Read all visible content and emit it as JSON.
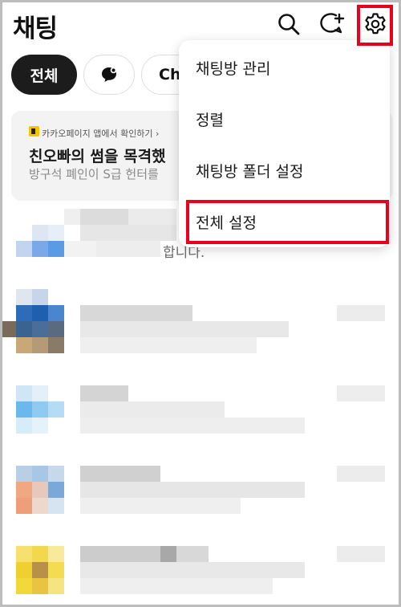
{
  "header": {
    "title": "채팅",
    "icons": [
      "search-icon",
      "new-chat-icon",
      "gear-icon"
    ]
  },
  "filters": {
    "all_label": "전체",
    "channel_label": "Ch",
    "icon_chip": "open-chat-bubble-icon"
  },
  "ad": {
    "source": "카카오페이지 앱에서 확인하기 ›",
    "title": "친오빠의 썸을 목격했",
    "subtitle": "방구석 폐인이 S급 헌터를"
  },
  "chat_list": {
    "visible_fragment": "합니다."
  },
  "menu": {
    "items": [
      "채팅방 관리",
      "정렬",
      "채팅방 폴더 설정",
      "전체 설정"
    ]
  },
  "colors": {
    "highlight": "#e8001c",
    "chip_active": "#1c1c1c",
    "ad_background": "#f3f3f3"
  }
}
